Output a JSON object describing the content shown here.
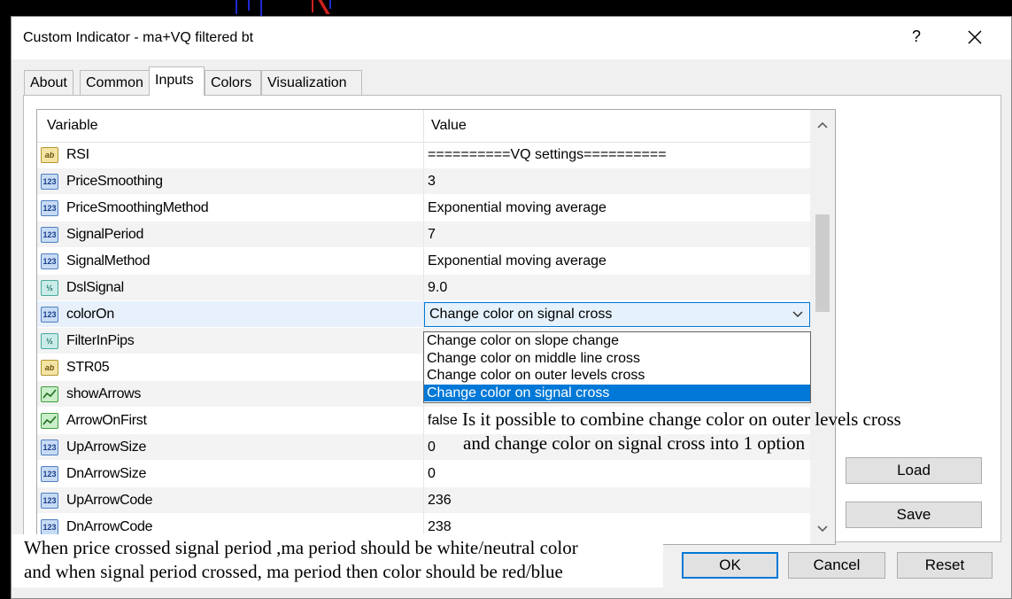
{
  "window": {
    "title": "Custom Indicator - ma+VQ filtered bt",
    "help_label": "?",
    "close_icon": "close-icon"
  },
  "tabs": [
    {
      "label": "About",
      "active": false
    },
    {
      "label": "Common",
      "active": false
    },
    {
      "label": "Inputs",
      "active": true
    },
    {
      "label": "Colors",
      "active": false
    },
    {
      "label": "Visualization",
      "active": false
    }
  ],
  "grid": {
    "headers": {
      "variable": "Variable",
      "value": "Value"
    },
    "rows": [
      {
        "type": "str",
        "icon_text": "ab",
        "name": "RSI",
        "value": "==========VQ settings=========="
      },
      {
        "type": "num",
        "icon_text": "123",
        "name": "PriceSmoothing",
        "value": "3"
      },
      {
        "type": "num",
        "icon_text": "123",
        "name": "PriceSmoothingMethod",
        "value": "Exponential moving average"
      },
      {
        "type": "num",
        "icon_text": "123",
        "name": "SignalPeriod",
        "value": "7"
      },
      {
        "type": "num",
        "icon_text": "123",
        "name": "SignalMethod",
        "value": "Exponential moving average"
      },
      {
        "type": "dbl",
        "icon_text": "½",
        "name": "DslSignal",
        "value": "9.0"
      },
      {
        "type": "num",
        "icon_text": "123",
        "name": "colorOn",
        "value": "Change color on signal cross"
      },
      {
        "type": "dbl",
        "icon_text": "½",
        "name": "FilterInPips",
        "value": ""
      },
      {
        "type": "str",
        "icon_text": "ab",
        "name": "STR05",
        "value": ""
      },
      {
        "type": "bool",
        "icon_text": "",
        "name": "showArrows",
        "value": ""
      },
      {
        "type": "bool",
        "icon_text": "",
        "name": "ArrowOnFirst",
        "value": "false"
      },
      {
        "type": "num",
        "icon_text": "123",
        "name": "UpArrowSize",
        "value": "0"
      },
      {
        "type": "num",
        "icon_text": "123",
        "name": "DnArrowSize",
        "value": "0"
      },
      {
        "type": "num",
        "icon_text": "123",
        "name": "UpArrowCode",
        "value": "236"
      },
      {
        "type": "num",
        "icon_text": "123",
        "name": "DnArrowCode",
        "value": "238"
      }
    ],
    "combo": {
      "selected": "Change color on signal cross",
      "options": [
        "Change color on slope change",
        "Change color on middle line cross",
        "Change color on outer levels cross",
        "Change color on signal cross"
      ]
    }
  },
  "buttons": {
    "load": "Load",
    "save": "Save",
    "ok": "OK",
    "cancel": "Cancel",
    "reset": "Reset"
  },
  "annotations": {
    "note_top_line1": "Is it possible to combine change color on outer levels cross",
    "note_top_line2": "and change color on signal cross into 1 option",
    "note_bottom_line1": "When price crossed signal period ,ma period should be white/neutral color",
    "note_bottom_line2": "and when signal period crossed, ma period then color should be red/blue"
  },
  "colors": {
    "accent": "#0078d7",
    "dialog_bg": "#f0f0f0"
  }
}
